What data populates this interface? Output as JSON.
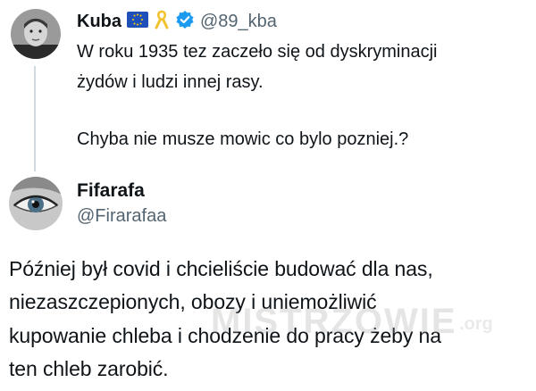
{
  "original_tweet": {
    "display_name": "Kuba",
    "handle": "@89_kba",
    "badges": [
      "eu-flag-icon",
      "yellow-ribbon-icon",
      "verified-badge-icon"
    ],
    "lines": [
      "W roku 1935 tez zaczeło się od dyskryminacji",
      "żydów i ludzi innej rasy.",
      "Chyba nie musze mowic co bylo pozniej.?"
    ]
  },
  "reply": {
    "display_name": "Fifarafa",
    "handle": "@Firarafaa",
    "lines": [
      "Później był covid i chcieliście budować dla nas,",
      "niezaszczepionych, obozy i uniemożliwić",
      "kupowanie chleba i chodzenie do pracy żeby na",
      "ten chleb zarobić."
    ]
  },
  "watermark": {
    "logo": "MISTRZOWIE",
    "suffix": ".org"
  },
  "colors": {
    "text": "#0f1419",
    "secondary": "#536471",
    "verified": "#1d9bf0",
    "thread_line": "#cfd9de"
  }
}
